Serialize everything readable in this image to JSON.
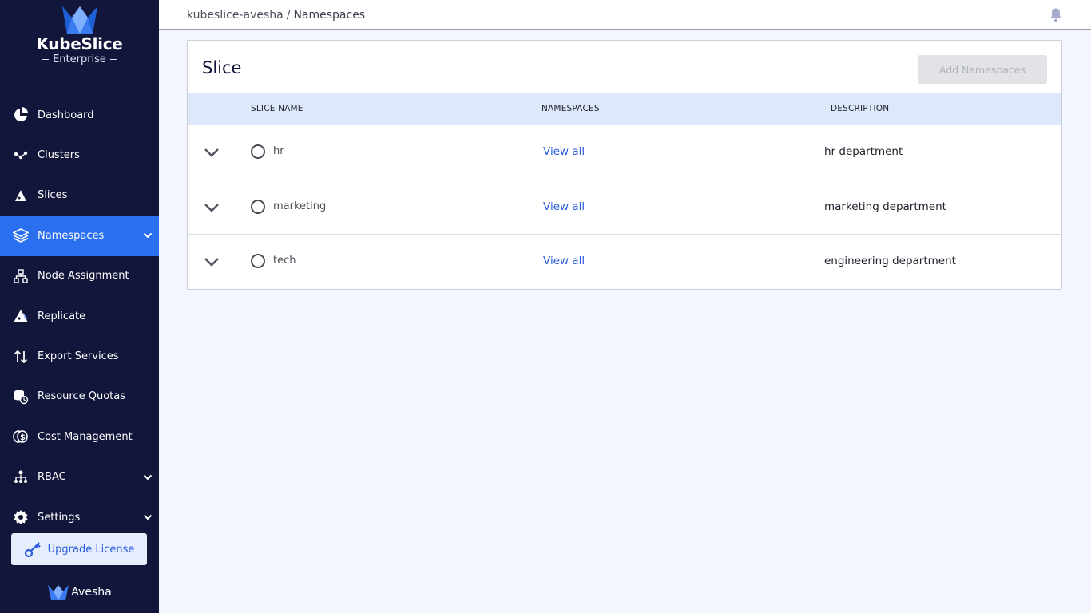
{
  "brand": {
    "name": "KubeSlice",
    "subtitle": "Enterprise"
  },
  "sidebar": {
    "items": [
      {
        "label": "Dashboard",
        "icon": "pie-chart-icon"
      },
      {
        "label": "Clusters",
        "icon": "cluster-nodes-icon"
      },
      {
        "label": "Slices",
        "icon": "slices-icon"
      },
      {
        "label": "Namespaces",
        "icon": "layers-icon",
        "active": true
      },
      {
        "label": "Node Assignment",
        "icon": "node-tree-icon"
      },
      {
        "label": "Replicate",
        "icon": "replicate-icon"
      },
      {
        "label": "Export Services",
        "icon": "up-down-arrows-icon"
      },
      {
        "label": "Resource Quotas",
        "icon": "resource-quota-icon"
      },
      {
        "label": "Cost Management",
        "icon": "cost-icon"
      },
      {
        "label": "RBAC",
        "icon": "rbac-icon"
      },
      {
        "label": "Settings",
        "icon": "gear-icon"
      }
    ],
    "upgrade_label": "Upgrade License",
    "footer_brand": "Avesha"
  },
  "header": {
    "breadcrumb_root": "kubeslice-avesha",
    "breadcrumb_sep": "/",
    "breadcrumb_current": "Namespaces"
  },
  "card": {
    "title": "Slice",
    "add_button": "Add Namespaces",
    "columns": [
      "SLICE NAME",
      "NAMESPACES",
      "DESCRIPTION"
    ],
    "rows": [
      {
        "name": "hr",
        "namespaces": "View all",
        "description": "hr department"
      },
      {
        "name": "marketing",
        "namespaces": "View all",
        "description": "marketing department"
      },
      {
        "name": "tech",
        "namespaces": "View all",
        "description": "engineering department"
      }
    ]
  },
  "colors": {
    "sidebar_bg": "#12163a",
    "accent": "#2a6ff0",
    "link": "#2a5ddc",
    "table_header_bg": "#dde8fb"
  }
}
